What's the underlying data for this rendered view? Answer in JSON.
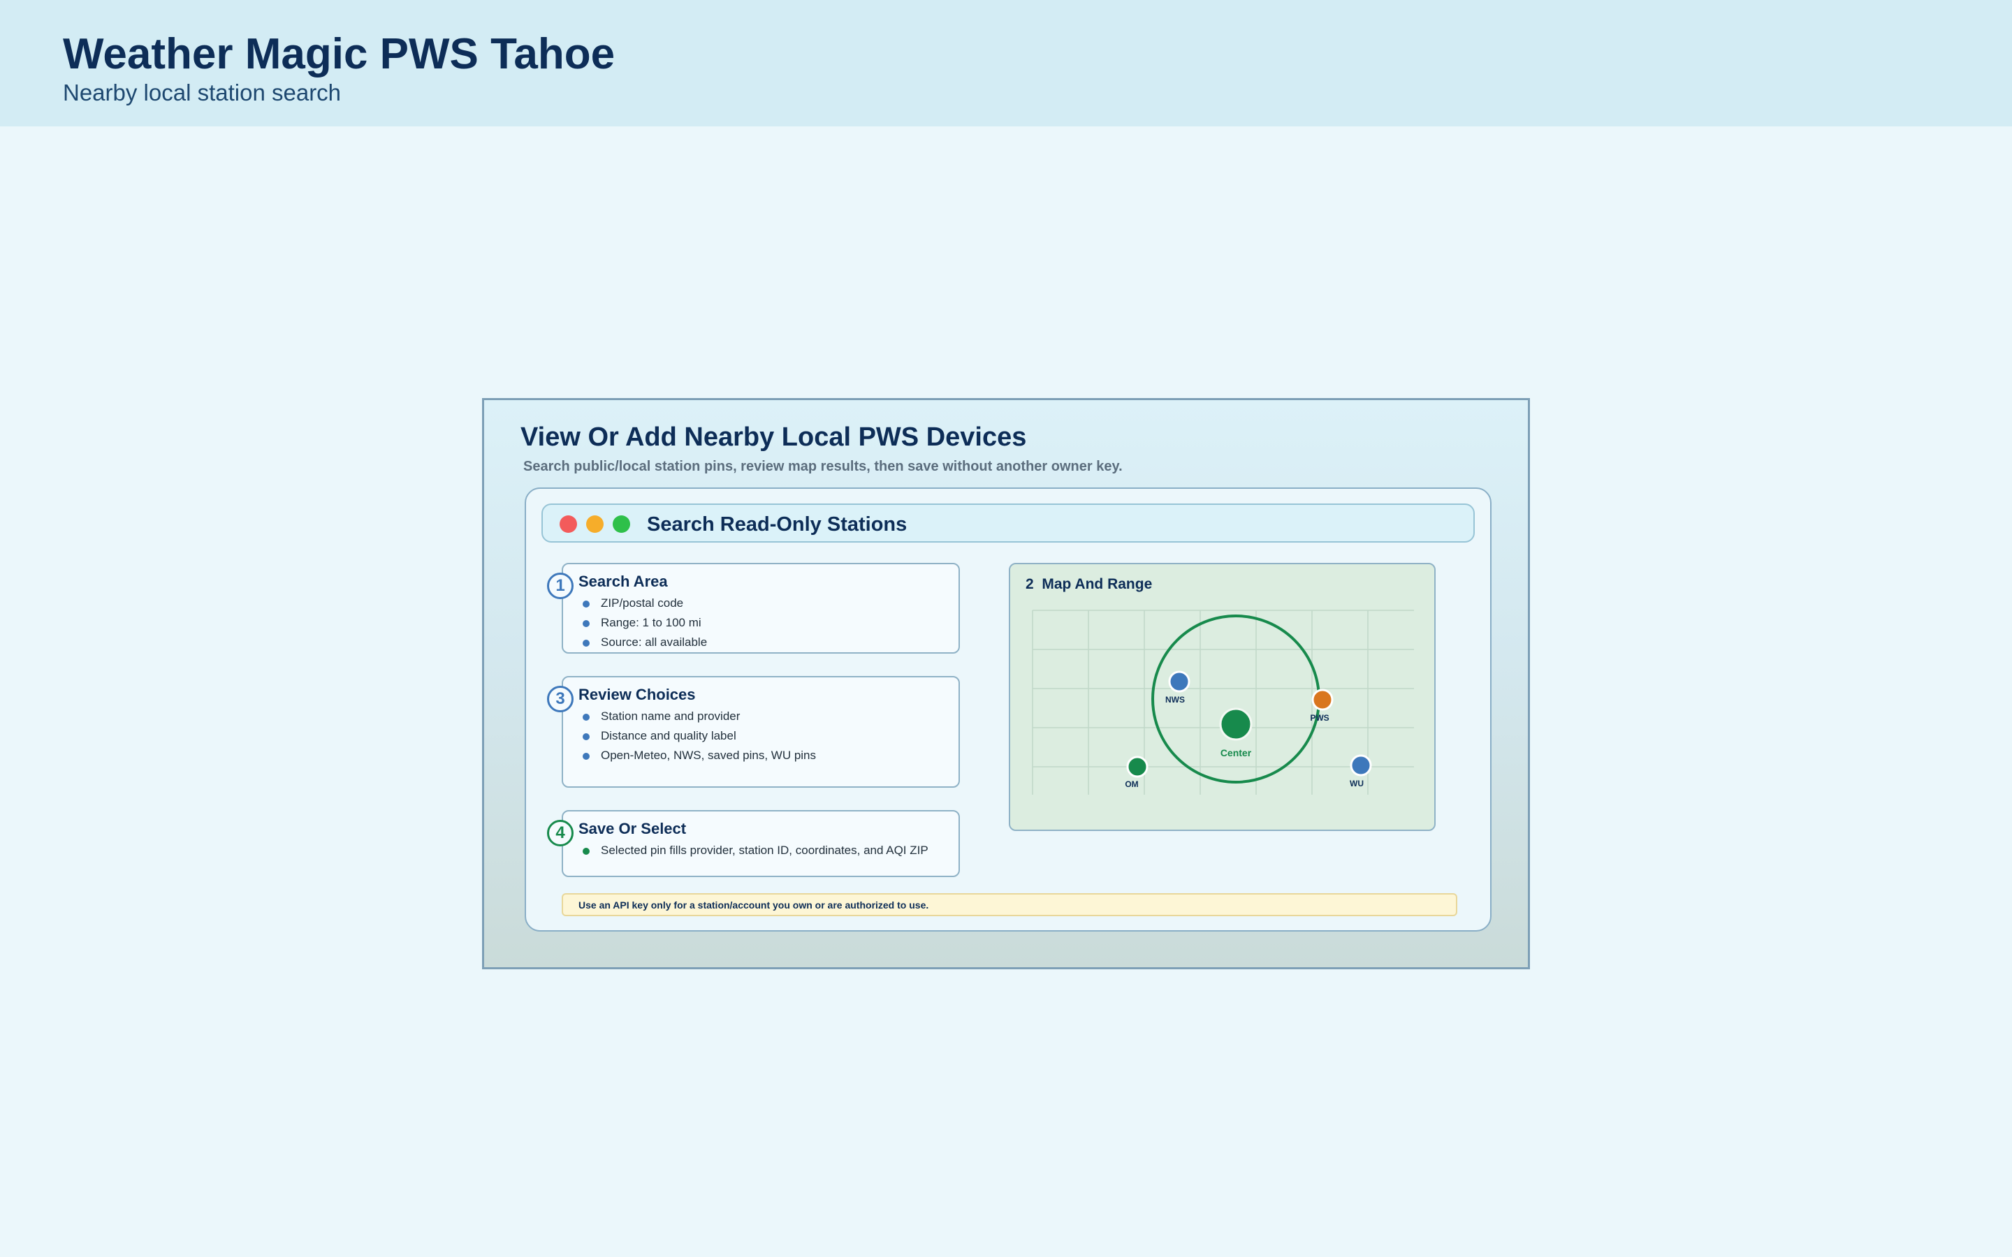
{
  "header": {
    "title": "Weather Magic PWS Tahoe",
    "subtitle": "Nearby local station search"
  },
  "panel": {
    "title": "View Or Add Nearby Local PWS Devices",
    "subtitle": "Search public/local station pins, review map results, then save without another owner key."
  },
  "window": {
    "title": "Search Read-Only Stations",
    "controls": [
      "close-icon",
      "minimize-icon",
      "maximize-icon"
    ],
    "colors": {
      "close": "#f35b5b",
      "minimize": "#f6ad2a",
      "maximize": "#2ec04a"
    }
  },
  "steps": [
    {
      "number": "1",
      "title": "Search Area",
      "items": [
        "ZIP/postal code",
        "Range: 1 to 100 mi",
        "Source: all available"
      ]
    },
    {
      "number": "3",
      "title": "Review Choices",
      "items": [
        "Station name and provider",
        "Distance and quality label",
        "Open-Meteo, NWS, saved pins, WU pins"
      ]
    },
    {
      "number": "4",
      "title": "Save Or Select",
      "items": [
        "Selected pin fills provider, station ID, coordinates, and AQI ZIP"
      ]
    }
  ],
  "map": {
    "number": "2",
    "title": "Map And Range",
    "center_label": "Center",
    "pins": [
      {
        "label": "NWS",
        "color": "#3e78bb"
      },
      {
        "label": "PWS",
        "color": "#d9761f"
      },
      {
        "label": "OM",
        "color": "#178a4c"
      },
      {
        "label": "WU",
        "color": "#3e78bb"
      }
    ],
    "range_color": "#178a4c"
  },
  "notice": {
    "text": "Use an API key only for a station/account you own or are authorized to use."
  }
}
